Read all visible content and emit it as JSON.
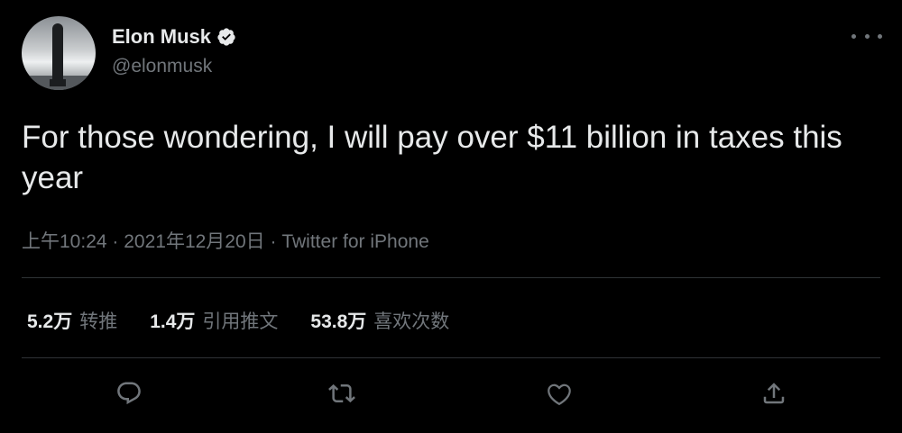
{
  "author": {
    "name": "Elon Musk",
    "handle": "@elonmusk",
    "avatar_icon": "starship-avatar",
    "verified_icon": "verified-badge-icon"
  },
  "tweet": {
    "text": "For those wondering, I will pay over $11 billion in taxes this year",
    "time": "上午10:24",
    "date": "2021年12月20日",
    "separator": " · ",
    "source": "Twitter for iPhone"
  },
  "stats": [
    {
      "count": "5.2万",
      "label": "转推"
    },
    {
      "count": "1.4万",
      "label": "引用推文"
    },
    {
      "count": "53.8万",
      "label": "喜欢次数"
    }
  ],
  "actions": [
    "reply-icon",
    "retweet-icon",
    "like-icon",
    "share-icon"
  ],
  "colors": {
    "background": "#000000",
    "text": "#e7e9ea",
    "secondary": "#71767b",
    "divider": "#2f3336"
  }
}
